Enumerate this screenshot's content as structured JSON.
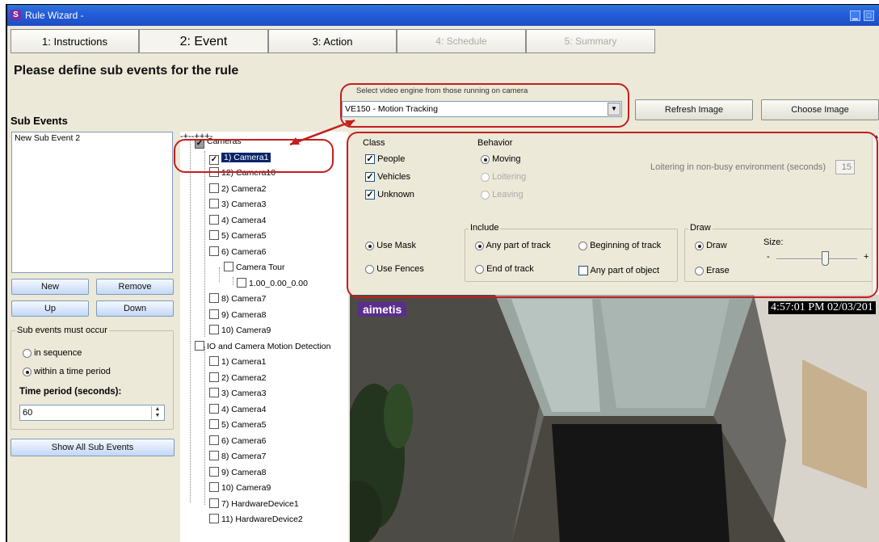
{
  "window": {
    "title": "Rule Wizard -",
    "icon_letter": "S"
  },
  "tabs": [
    {
      "label": "1: Instructions",
      "state": "normal"
    },
    {
      "label": "2: Event",
      "state": "active"
    },
    {
      "label": "3: Action",
      "state": "normal"
    },
    {
      "label": "4: Schedule",
      "state": "disabled"
    },
    {
      "label": "5: Summary",
      "state": "disabled"
    }
  ],
  "page_title": "Please define sub events for the rule",
  "sub_events": {
    "heading": "Sub Events",
    "items": [
      "New Sub Event 2"
    ],
    "buttons": {
      "new": "New",
      "remove": "Remove",
      "up": "Up",
      "down": "Down"
    },
    "order_group": {
      "caption": "Sub events must occur",
      "options": [
        "in sequence",
        "within a time period"
      ],
      "selected": "within a time period"
    },
    "time_period": {
      "label": "Time period (seconds):",
      "value": "60"
    },
    "show_all": "Show All Sub Events"
  },
  "tree": [
    {
      "label": "Cameras",
      "checked": "partial"
    },
    {
      "label": "1) Camera1",
      "checked": true,
      "selected": true
    },
    {
      "label": "12) Camera10",
      "checked": false
    },
    {
      "label": "2) Camera2",
      "checked": false
    },
    {
      "label": "3) Camera3",
      "checked": false
    },
    {
      "label": "4) Camera4",
      "checked": false
    },
    {
      "label": "5) Camera5",
      "checked": false
    },
    {
      "label": "6) Camera6",
      "checked": false
    },
    {
      "label": "Camera Tour",
      "checked": false
    },
    {
      "label": "1.00_0.00_0.00",
      "checked": false
    },
    {
      "label": "8) Camera7",
      "checked": false
    },
    {
      "label": "9) Camera8",
      "checked": false
    },
    {
      "label": "10) Camera9",
      "checked": false
    },
    {
      "label": "IO and Camera Motion Detection",
      "checked": false
    },
    {
      "label": "1) Camera1",
      "checked": false
    },
    {
      "label": "2) Camera2",
      "checked": false
    },
    {
      "label": "3) Camera3",
      "checked": false
    },
    {
      "label": "4) Camera4",
      "checked": false
    },
    {
      "label": "5) Camera5",
      "checked": false
    },
    {
      "label": "6) Camera6",
      "checked": false
    },
    {
      "label": "8) Camera7",
      "checked": false
    },
    {
      "label": "9) Camera8",
      "checked": false
    },
    {
      "label": "10) Camera9",
      "checked": false
    },
    {
      "label": "7) HardwareDevice1",
      "checked": false
    },
    {
      "label": "11) HardwareDevice2",
      "checked": false
    }
  ],
  "engine": {
    "label": "Select video engine from those running on camera",
    "value": "VE150 - Motion Tracking",
    "refresh": "Refresh Image",
    "choose": "Choose Image"
  },
  "settings": {
    "class": {
      "caption": "Class",
      "options": [
        {
          "label": "People",
          "checked": true
        },
        {
          "label": "Vehicles",
          "checked": true
        },
        {
          "label": "Unknown",
          "checked": true
        }
      ]
    },
    "behavior": {
      "caption": "Behavior",
      "options": [
        {
          "label": "Moving",
          "selected": true,
          "enabled": true
        },
        {
          "label": "Loitering",
          "selected": false,
          "enabled": false
        },
        {
          "label": "Leaving",
          "selected": false,
          "enabled": false
        }
      ]
    },
    "loiter": {
      "label": "Loitering in non-busy environment (seconds)",
      "value": "15"
    },
    "mask": {
      "options": [
        "Use Mask",
        "Use Fences"
      ],
      "selected": "Use Mask"
    },
    "include": {
      "caption": "Include",
      "options": [
        "Any part of track",
        "Beginning of track",
        "End of track"
      ],
      "selected": "Any part of track",
      "object_label": "Any part of object",
      "object_checked": false
    },
    "draw": {
      "caption": "Draw",
      "options": [
        "Draw",
        "Erase"
      ],
      "selected": "Draw",
      "size_label": "Size:",
      "minus": "-",
      "plus": "+",
      "size_level": 0.6
    }
  },
  "video": {
    "brand": "aimetis",
    "timestamp": "4:57:01 PM 02/03/201"
  },
  "colors": {
    "title_bar": "#245edb",
    "selection": "#0a246a",
    "annotation_red": "#c41e1e"
  }
}
